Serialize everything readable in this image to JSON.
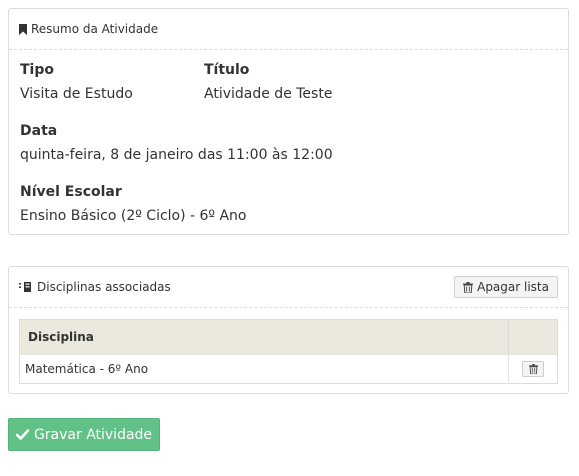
{
  "summary": {
    "title": "Resumo da Atividade",
    "tipo_label": "Tipo",
    "tipo_value": "Visita de Estudo",
    "titulo_label": "Título",
    "titulo_value": "Atividade de Teste",
    "data_label": "Data",
    "data_value": "quinta-feira, 8 de janeiro das 11:00 às 12:00",
    "nivel_label": "Nível Escolar",
    "nivel_value": "Ensino Básico (2º Ciclo) - 6º Ano"
  },
  "disciplines": {
    "title": "Disciplinas associadas",
    "clear_button": "Apagar lista",
    "column_header": "Disciplina",
    "rows": [
      {
        "name": "Matemática - 6º Ano"
      }
    ]
  },
  "actions": {
    "save_button": "Gravar Atividade"
  },
  "colors": {
    "save_button_bg": "#62c187",
    "table_header_bg": "#ebe9dd"
  }
}
